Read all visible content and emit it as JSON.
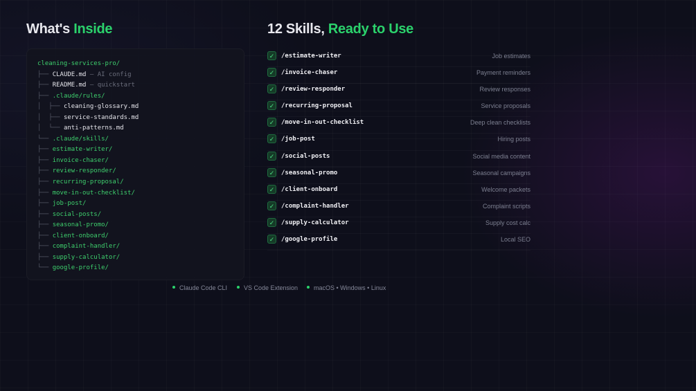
{
  "left_heading": {
    "prefix": "What's",
    "accent": "Inside"
  },
  "right_heading": {
    "prefix": "12 Skills,",
    "accent": "Ready to Use"
  },
  "tree": [
    {
      "branch": "",
      "name": "cleaning-services-pro/",
      "kind": "dir",
      "note": ""
    },
    {
      "branch": "├── ",
      "name": "CLAUDE.md",
      "kind": "file",
      "note": " — AI config"
    },
    {
      "branch": "├── ",
      "name": "README.md",
      "kind": "file",
      "note": " — quickstart"
    },
    {
      "branch": "├── ",
      "name": ".claude/rules/",
      "kind": "dir",
      "note": ""
    },
    {
      "branch": "│  ├── ",
      "name": "cleaning-glossary.md",
      "kind": "file",
      "note": ""
    },
    {
      "branch": "│  ├── ",
      "name": "service-standards.md",
      "kind": "file",
      "note": ""
    },
    {
      "branch": "│  └── ",
      "name": "anti-patterns.md",
      "kind": "file",
      "note": ""
    },
    {
      "branch": "└── ",
      "name": ".claude/skills/",
      "kind": "dir",
      "note": ""
    },
    {
      "branch": "├── ",
      "name": "estimate-writer/",
      "kind": "dir",
      "note": ""
    },
    {
      "branch": "├── ",
      "name": "invoice-chaser/",
      "kind": "dir",
      "note": ""
    },
    {
      "branch": "├── ",
      "name": "review-responder/",
      "kind": "dir",
      "note": ""
    },
    {
      "branch": "├── ",
      "name": "recurring-proposal/",
      "kind": "dir",
      "note": ""
    },
    {
      "branch": "├── ",
      "name": "move-in-out-checklist/",
      "kind": "dir",
      "note": ""
    },
    {
      "branch": "├── ",
      "name": "job-post/",
      "kind": "dir",
      "note": ""
    },
    {
      "branch": "├── ",
      "name": "social-posts/",
      "kind": "dir",
      "note": ""
    },
    {
      "branch": "├── ",
      "name": "seasonal-promo/",
      "kind": "dir",
      "note": ""
    },
    {
      "branch": "├── ",
      "name": "client-onboard/",
      "kind": "dir",
      "note": ""
    },
    {
      "branch": "├── ",
      "name": "complaint-handler/",
      "kind": "dir",
      "note": ""
    },
    {
      "branch": "├── ",
      "name": "supply-calculator/",
      "kind": "dir",
      "note": ""
    },
    {
      "branch": "└── ",
      "name": "google-profile/",
      "kind": "dir",
      "note": ""
    }
  ],
  "check_glyph": "✓",
  "skills": [
    {
      "command": "/estimate-writer",
      "description": "Job estimates"
    },
    {
      "command": "/invoice-chaser",
      "description": "Payment reminders"
    },
    {
      "command": "/review-responder",
      "description": "Review responses"
    },
    {
      "command": "/recurring-proposal",
      "description": "Service proposals"
    },
    {
      "command": "/move-in-out-checklist",
      "description": "Deep clean checklists"
    },
    {
      "command": "/job-post",
      "description": "Hiring posts"
    },
    {
      "command": "/social-posts",
      "description": "Social media content"
    },
    {
      "command": "/seasonal-promo",
      "description": "Seasonal campaigns"
    },
    {
      "command": "/client-onboard",
      "description": "Welcome packets"
    },
    {
      "command": "/complaint-handler",
      "description": "Complaint scripts"
    },
    {
      "command": "/supply-calculator",
      "description": "Supply cost calc"
    },
    {
      "command": "/google-profile",
      "description": "Local SEO"
    }
  ],
  "footer": [
    {
      "label": "Claude Code CLI"
    },
    {
      "label": "VS Code Extension"
    },
    {
      "label": "macOS • Windows • Linux"
    }
  ],
  "colors": {
    "accent": "#2bd26c",
    "background": "#0e0f1b",
    "panel": "#12131e",
    "muted": "#7d8091"
  }
}
